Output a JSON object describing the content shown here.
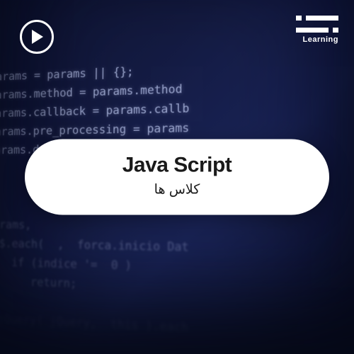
{
  "brand": {
    "label": "Learning"
  },
  "card": {
    "title": "Java Script",
    "subtitle": "کلاس ها"
  },
  "code_lines": [
    "params = params || {};",
    "params.method = params.method",
    "params.callback = params.callb",
    "params.pre_processing = params",
    "params.data = params.data || {}",
    " ",
    " ",
    " ",
    "params,",
    "  $.each(  ,  forca.inicio Dat",
    "    if (indice '=  0 )",
    "       return;",
    " ",
    "  jQuery( jQuery,  this ).each"
  ]
}
